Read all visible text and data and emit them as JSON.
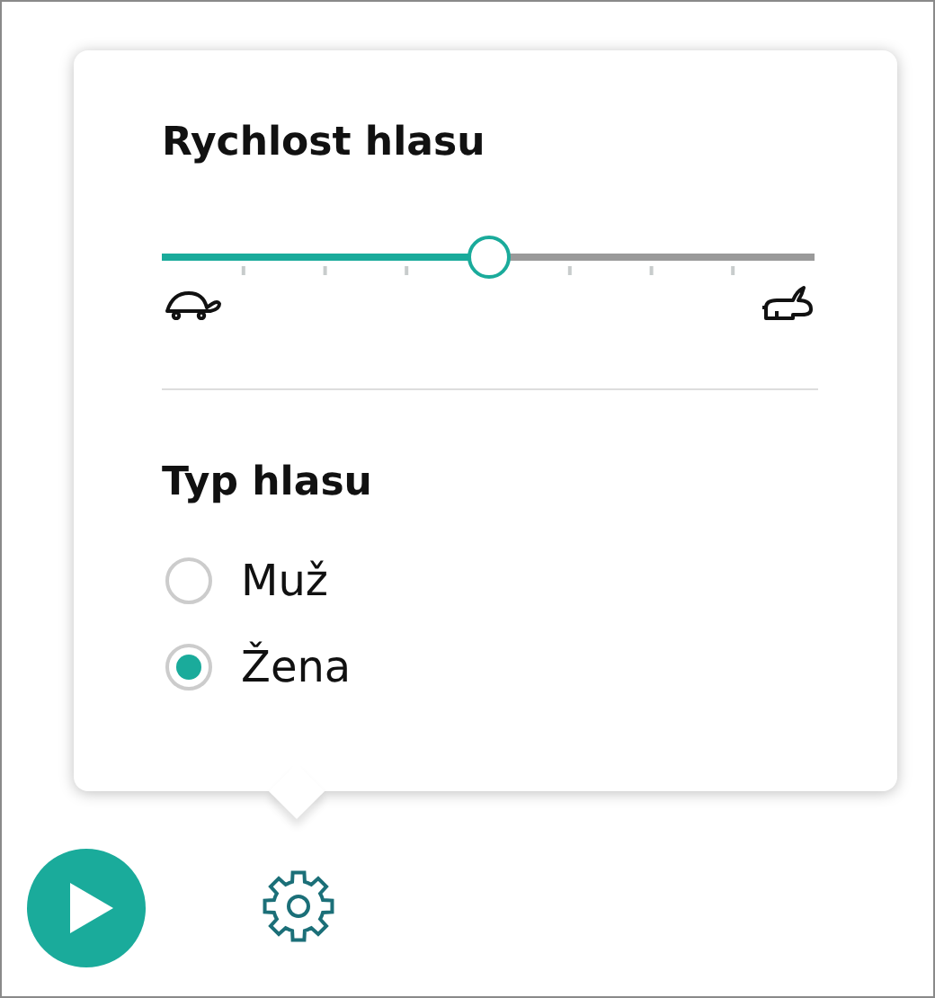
{
  "speed": {
    "title": "Rychlost hlasu",
    "level": 0.5
  },
  "voice_type": {
    "title": "Typ hlasu",
    "options": [
      {
        "label": "Muž",
        "selected": false
      },
      {
        "label": "Žena",
        "selected": true
      }
    ]
  }
}
